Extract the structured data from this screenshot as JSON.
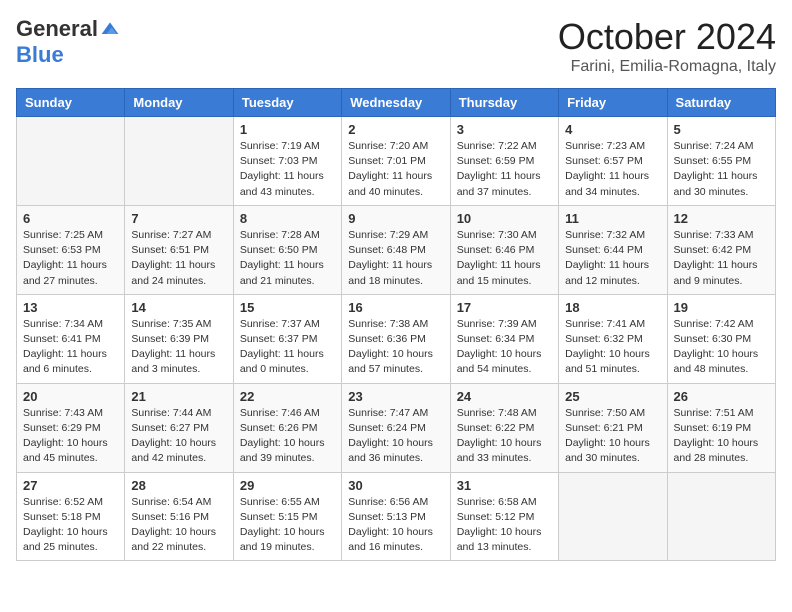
{
  "logo": {
    "general": "General",
    "blue": "Blue"
  },
  "title": "October 2024",
  "location": "Farini, Emilia-Romagna, Italy",
  "days_of_week": [
    "Sunday",
    "Monday",
    "Tuesday",
    "Wednesday",
    "Thursday",
    "Friday",
    "Saturday"
  ],
  "weeks": [
    [
      {
        "day": "",
        "empty": true
      },
      {
        "day": "",
        "empty": true
      },
      {
        "day": "1",
        "sunrise": "7:19 AM",
        "sunset": "7:03 PM",
        "daylight": "11 hours and 43 minutes."
      },
      {
        "day": "2",
        "sunrise": "7:20 AM",
        "sunset": "7:01 PM",
        "daylight": "11 hours and 40 minutes."
      },
      {
        "day": "3",
        "sunrise": "7:22 AM",
        "sunset": "6:59 PM",
        "daylight": "11 hours and 37 minutes."
      },
      {
        "day": "4",
        "sunrise": "7:23 AM",
        "sunset": "6:57 PM",
        "daylight": "11 hours and 34 minutes."
      },
      {
        "day": "5",
        "sunrise": "7:24 AM",
        "sunset": "6:55 PM",
        "daylight": "11 hours and 30 minutes."
      }
    ],
    [
      {
        "day": "6",
        "sunrise": "7:25 AM",
        "sunset": "6:53 PM",
        "daylight": "11 hours and 27 minutes."
      },
      {
        "day": "7",
        "sunrise": "7:27 AM",
        "sunset": "6:51 PM",
        "daylight": "11 hours and 24 minutes."
      },
      {
        "day": "8",
        "sunrise": "7:28 AM",
        "sunset": "6:50 PM",
        "daylight": "11 hours and 21 minutes."
      },
      {
        "day": "9",
        "sunrise": "7:29 AM",
        "sunset": "6:48 PM",
        "daylight": "11 hours and 18 minutes."
      },
      {
        "day": "10",
        "sunrise": "7:30 AM",
        "sunset": "6:46 PM",
        "daylight": "11 hours and 15 minutes."
      },
      {
        "day": "11",
        "sunrise": "7:32 AM",
        "sunset": "6:44 PM",
        "daylight": "11 hours and 12 minutes."
      },
      {
        "day": "12",
        "sunrise": "7:33 AM",
        "sunset": "6:42 PM",
        "daylight": "11 hours and 9 minutes."
      }
    ],
    [
      {
        "day": "13",
        "sunrise": "7:34 AM",
        "sunset": "6:41 PM",
        "daylight": "11 hours and 6 minutes."
      },
      {
        "day": "14",
        "sunrise": "7:35 AM",
        "sunset": "6:39 PM",
        "daylight": "11 hours and 3 minutes."
      },
      {
        "day": "15",
        "sunrise": "7:37 AM",
        "sunset": "6:37 PM",
        "daylight": "11 hours and 0 minutes."
      },
      {
        "day": "16",
        "sunrise": "7:38 AM",
        "sunset": "6:36 PM",
        "daylight": "10 hours and 57 minutes."
      },
      {
        "day": "17",
        "sunrise": "7:39 AM",
        "sunset": "6:34 PM",
        "daylight": "10 hours and 54 minutes."
      },
      {
        "day": "18",
        "sunrise": "7:41 AM",
        "sunset": "6:32 PM",
        "daylight": "10 hours and 51 minutes."
      },
      {
        "day": "19",
        "sunrise": "7:42 AM",
        "sunset": "6:30 PM",
        "daylight": "10 hours and 48 minutes."
      }
    ],
    [
      {
        "day": "20",
        "sunrise": "7:43 AM",
        "sunset": "6:29 PM",
        "daylight": "10 hours and 45 minutes."
      },
      {
        "day": "21",
        "sunrise": "7:44 AM",
        "sunset": "6:27 PM",
        "daylight": "10 hours and 42 minutes."
      },
      {
        "day": "22",
        "sunrise": "7:46 AM",
        "sunset": "6:26 PM",
        "daylight": "10 hours and 39 minutes."
      },
      {
        "day": "23",
        "sunrise": "7:47 AM",
        "sunset": "6:24 PM",
        "daylight": "10 hours and 36 minutes."
      },
      {
        "day": "24",
        "sunrise": "7:48 AM",
        "sunset": "6:22 PM",
        "daylight": "10 hours and 33 minutes."
      },
      {
        "day": "25",
        "sunrise": "7:50 AM",
        "sunset": "6:21 PM",
        "daylight": "10 hours and 30 minutes."
      },
      {
        "day": "26",
        "sunrise": "7:51 AM",
        "sunset": "6:19 PM",
        "daylight": "10 hours and 28 minutes."
      }
    ],
    [
      {
        "day": "27",
        "sunrise": "6:52 AM",
        "sunset": "5:18 PM",
        "daylight": "10 hours and 25 minutes."
      },
      {
        "day": "28",
        "sunrise": "6:54 AM",
        "sunset": "5:16 PM",
        "daylight": "10 hours and 22 minutes."
      },
      {
        "day": "29",
        "sunrise": "6:55 AM",
        "sunset": "5:15 PM",
        "daylight": "10 hours and 19 minutes."
      },
      {
        "day": "30",
        "sunrise": "6:56 AM",
        "sunset": "5:13 PM",
        "daylight": "10 hours and 16 minutes."
      },
      {
        "day": "31",
        "sunrise": "6:58 AM",
        "sunset": "5:12 PM",
        "daylight": "10 hours and 13 minutes."
      },
      {
        "day": "",
        "empty": true
      },
      {
        "day": "",
        "empty": true
      }
    ]
  ]
}
